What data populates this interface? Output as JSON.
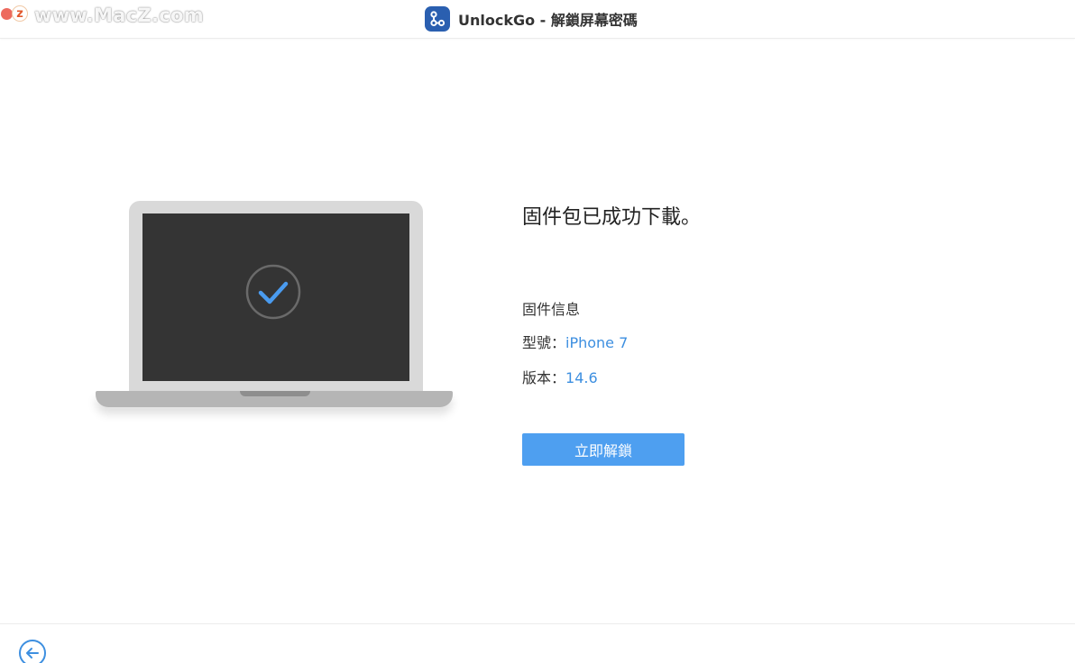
{
  "titlebar": {
    "watermark_logo": "z",
    "watermark_text": "www.MacZ.com",
    "window_title": "UnlockGo - 解鎖屏幕密碼"
  },
  "main": {
    "headline": "固件包已成功下載。",
    "firmware_info": {
      "title": "固件信息",
      "model_label": "型號：",
      "model_value": "iPhone 7",
      "version_label": "版本：",
      "version_value": "14.6"
    },
    "unlock_button_label": "立即解鎖"
  },
  "colors": {
    "accent": "#4e9ff0",
    "value_text": "#3d8fe0",
    "screen": "#343434",
    "check": "#4a9bef"
  },
  "icons": {
    "app": "unlockgo-app-icon",
    "check": "check-circle-icon",
    "back": "arrow-left-circle-icon"
  }
}
